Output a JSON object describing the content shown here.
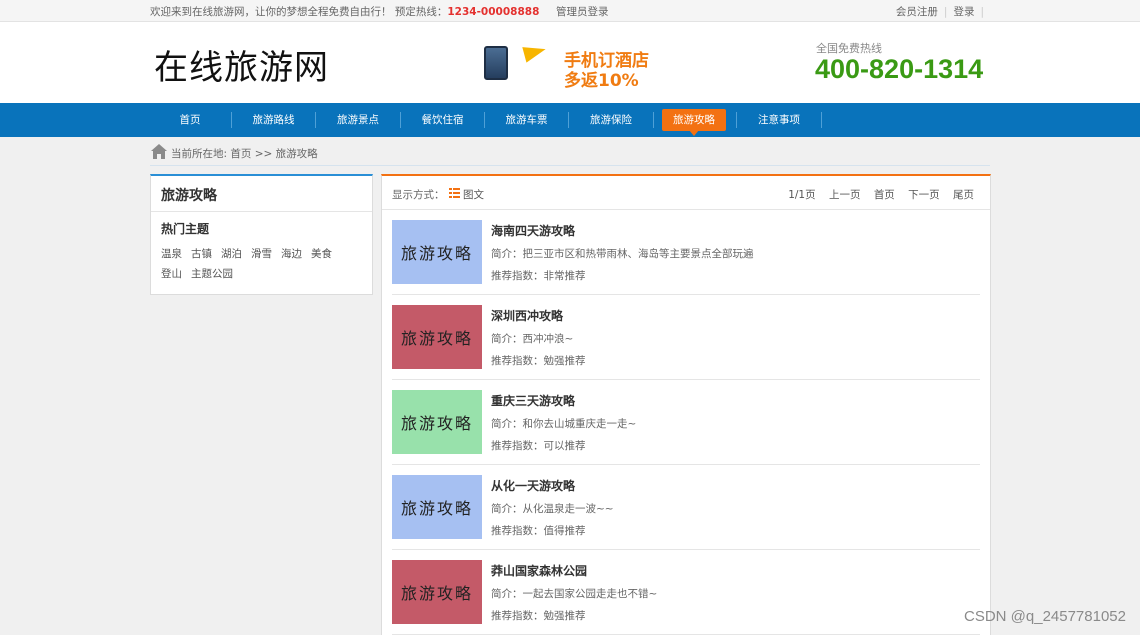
{
  "topbar": {
    "welcome": "欢迎来到在线旅游网，让你的梦想全程免费自由行！ 预定热线：",
    "hotline": "1234-00008888",
    "admin_login": "管理员登录",
    "register": "会员注册",
    "login": "登录"
  },
  "header": {
    "logo": "在线旅游网",
    "promo_line1": "手机订酒店",
    "promo_line2": "多返10%",
    "hotline_label": "全国免费热线",
    "hotline_number": "400-820-1314"
  },
  "nav": {
    "items": [
      "首页",
      "旅游路线",
      "旅游景点",
      "餐饮住宿",
      "旅游车票",
      "旅游保险",
      "旅游攻略",
      "注意事项"
    ],
    "active": "旅游攻略"
  },
  "breadcrumb": {
    "text": "当前所在地:  首页 >> 旅游攻略"
  },
  "sidebar": {
    "title": "旅游攻略",
    "subtitle": "热门主题",
    "tags": [
      "温泉",
      "古镇",
      "湖泊",
      "滑雪",
      "海边",
      "美食",
      "登山",
      "主题公园"
    ]
  },
  "main": {
    "mode_label": "显示方式：",
    "mode_text": "图文",
    "pager": {
      "info": "1/1页",
      "prev": "上一页",
      "first": "首页",
      "next": "下一页",
      "last": "尾页"
    },
    "items": [
      {
        "thumb_text": "旅游攻略",
        "color": "#a6c0f2",
        "title": "海南四天游攻略",
        "intro": "简介：把三亚市区和热带雨林、海岛等主要景点全部玩遍",
        "level": "推荐指数：非常推荐"
      },
      {
        "thumb_text": "旅游攻略",
        "color": "#c45a68",
        "title": "深圳西冲攻略",
        "intro": "简介：西冲冲浪~",
        "level": "推荐指数：勉强推荐"
      },
      {
        "thumb_text": "旅游攻略",
        "color": "#98e1ab",
        "title": "重庆三天游攻略",
        "intro": "简介：和你去山城重庆走一走~",
        "level": "推荐指数：可以推荐"
      },
      {
        "thumb_text": "旅游攻略",
        "color": "#a6c0f2",
        "title": "从化一天游攻略",
        "intro": "简介：从化温泉走一波~~",
        "level": "推荐指数：值得推荐"
      },
      {
        "thumb_text": "旅游攻略",
        "color": "#c45a68",
        "title": "莽山国家森林公园",
        "intro": "简介：一起去国家公园走走也不错~",
        "level": "推荐指数：勉强推荐"
      }
    ]
  },
  "watermark": "CSDN @q_2457781052",
  "colors": {
    "nav": "#0973bb",
    "active": "#f37112",
    "hotline": "#3a9a14"
  }
}
